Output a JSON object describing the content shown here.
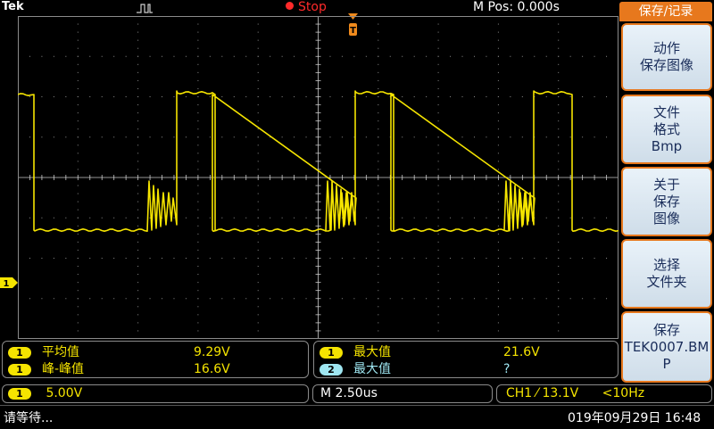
{
  "header": {
    "brand": "Tek",
    "run_state": "Stop",
    "horizontal_position": "M Pos: 0.000s",
    "colors": {
      "run_state": "#ff2a2a",
      "trigger_marker": "#f08a1c"
    }
  },
  "side_menu": {
    "title": "保存/记录",
    "buttons": [
      {
        "lines": [
          "动作",
          "保存图像"
        ]
      },
      {
        "lines": [
          "文件",
          "格式",
          "Bmp"
        ]
      },
      {
        "lines": [
          "关于",
          "保存",
          "图像"
        ]
      },
      {
        "lines": [
          "选择",
          "文件夹"
        ]
      },
      {
        "lines": [
          "保存",
          "TEK0007.BM",
          "P"
        ]
      }
    ],
    "colors": {
      "accent": "#e7781d",
      "button_text": "#1a2d5a"
    }
  },
  "channel_marker": {
    "label": "1"
  },
  "measurements_left": [
    {
      "channel": "1",
      "label": "平均值",
      "value": "9.29V"
    },
    {
      "channel": "1",
      "label": "峰-峰值",
      "value": "16.6V"
    }
  ],
  "measurements_right": [
    {
      "channel": "1",
      "label": "最大值",
      "value": "21.6V"
    },
    {
      "channel": "2",
      "label": "最大值",
      "value": "?"
    }
  ],
  "status": {
    "ch1_scale_badge": "1",
    "ch1_scale": "5.00V",
    "timebase": "M 2.50us",
    "trigger_source": "CH1",
    "trigger_slope_symbol": "⁄",
    "trigger_level": "13.1V",
    "trigger_freq": "<10Hz"
  },
  "bottom": {
    "message": "请等待...",
    "datetime": "019年09月29日 16:48"
  },
  "colors": {
    "ch1": "#f5e400",
    "ch2": "#9fe7f2",
    "grid": "#9a9a9a",
    "background": "#000000"
  }
}
